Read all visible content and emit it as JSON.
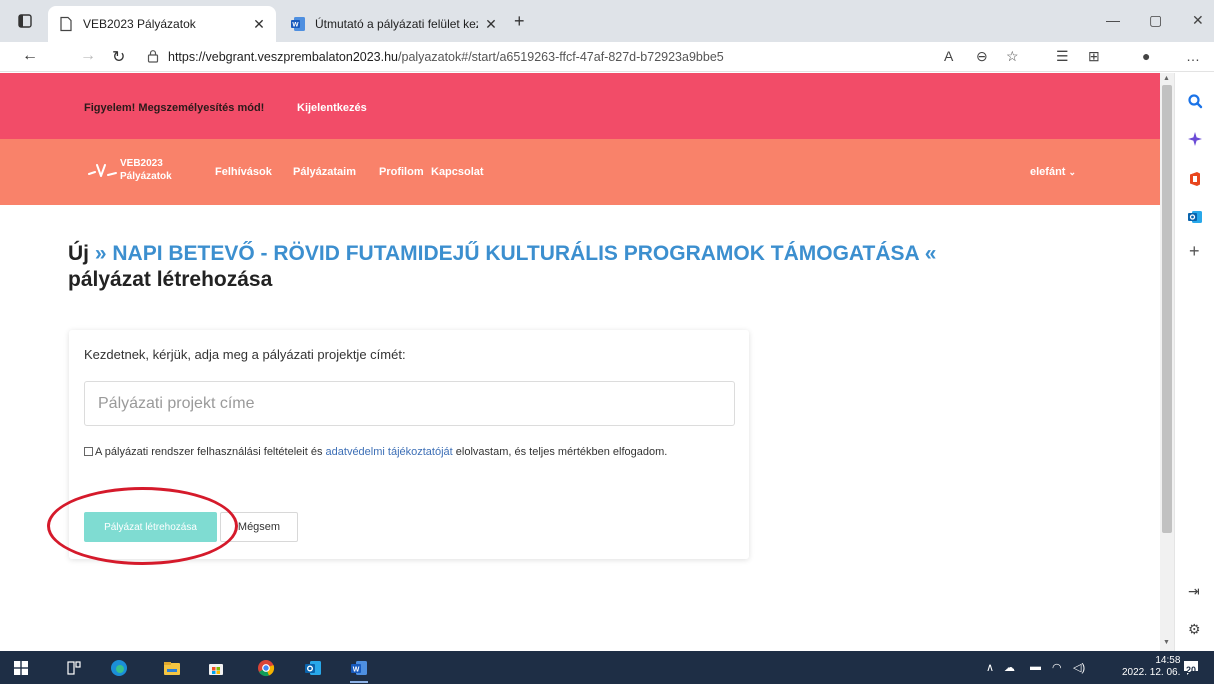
{
  "browser": {
    "tabs": [
      {
        "title": "VEB2023 Pályázatok",
        "active": true
      },
      {
        "title": "Útmutató a pályázati felület keze",
        "active": false
      }
    ],
    "url_host": "https://vebgrant.veszprembalaton2023.hu",
    "url_path": "/palyazatok#/start/a6519263-ffcf-47af-827d-b72923a9bbe5",
    "colors": {
      "tabstrip": "#dfe3e8"
    }
  },
  "impersonation_bar": {
    "warning": "Figyelem! Megszemélyesítés mód!",
    "logout": "Kijelentkezés",
    "color": "#f24c68"
  },
  "navbar": {
    "logo_line1": "VEB2023",
    "logo_line2": "Pályázatok",
    "links": [
      "Felhívások",
      "Pályázataim",
      "Profilom",
      "Kapcsolat"
    ],
    "user": "elefánt",
    "color": "#f9826a"
  },
  "heading": {
    "prefix": "Új",
    "call_name": "» NAPI BETEVŐ - RÖVID FUTAMIDEJŰ KULTURÁLIS PROGRAMOK TÁMOGATÁSA «",
    "suffix": "pályázat létrehozása",
    "call_color": "#3c8fcf"
  },
  "form": {
    "prompt": "Kezdetnek, kérjük, adja meg a pályázati projektje címét:",
    "title_placeholder": "Pályázati projekt címe",
    "title_value": "",
    "consent_before": "A pályázati rendszer felhasználási feltételeit és ",
    "consent_link": "adatvédelmi tájékoztatóját",
    "consent_after": " elolvastam, és teljes mértékben elfogadom.",
    "consent_checked": false,
    "create_button": "Pályázat létrehozása",
    "cancel_button": "Mégsem",
    "create_color": "#7fdcd2",
    "annotation_color": "#d51a2b"
  },
  "taskbar": {
    "time": "14:58",
    "date": "2022. 12. 06.",
    "notifications": "20"
  }
}
